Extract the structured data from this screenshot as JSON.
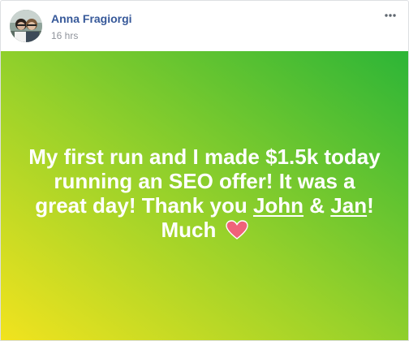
{
  "post": {
    "author_name": "Anna Fragiorgi",
    "timestamp": "16 hrs",
    "text_part1": "My first run and I made $1.5k today running an SEO offer! It was a great day! Thank you ",
    "mention1": "John",
    "joiner": " & ",
    "mention2": "Jan",
    "text_part2": "! Much ",
    "emoji_icon": "heart-icon",
    "background_colors": [
      "#f2e31e",
      "#9ad22a",
      "#2cb537"
    ],
    "text_color": "#ffffff",
    "link_color": "#365899"
  },
  "icons": {
    "more_options": "more-options-icon"
  }
}
